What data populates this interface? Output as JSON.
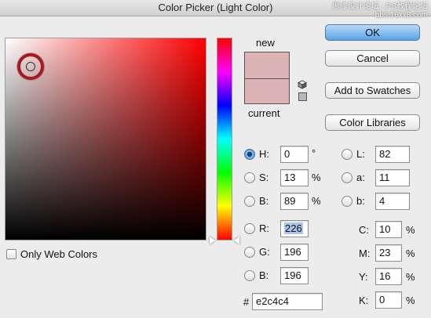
{
  "window": {
    "title": "Color Picker (Light Color)",
    "watermark_line1": "思缘设计论坛 · PS教程论坛",
    "watermark_line2": "bbs.16xx8.com"
  },
  "preview": {
    "new_label": "new",
    "current_label": "current",
    "new_color": "#dcb4b6",
    "current_color": "#dcb4b6"
  },
  "buttons": {
    "ok": "OK",
    "cancel": "Cancel",
    "add_swatches": "Add to Swatches",
    "color_libraries": "Color Libraries"
  },
  "options": {
    "only_web_colors": "Only Web Colors",
    "only_web_colors_checked": false
  },
  "hsb": {
    "h_label": "H:",
    "h_value": "0",
    "h_unit": "°",
    "h_selected": true,
    "s_label": "S:",
    "s_value": "13",
    "s_unit": "%",
    "b_label": "B:",
    "b_value": "89",
    "b_unit": "%"
  },
  "rgb": {
    "r_label": "R:",
    "r_value": "226",
    "g_label": "G:",
    "g_value": "196",
    "b_label": "B:",
    "b_value": "196"
  },
  "lab": {
    "l_label": "L:",
    "l_value": "82",
    "a_label": "a:",
    "a_value": "11",
    "b_label": "b:",
    "b_value": "4"
  },
  "cmyk": {
    "c_label": "C:",
    "c_value": "10",
    "c_unit": "%",
    "m_label": "M:",
    "m_value": "23",
    "m_unit": "%",
    "y_label": "Y:",
    "y_value": "16",
    "y_unit": "%",
    "k_label": "K:",
    "k_value": "0",
    "k_unit": "%"
  },
  "hex": {
    "label": "#",
    "value": "e2c4c4"
  }
}
